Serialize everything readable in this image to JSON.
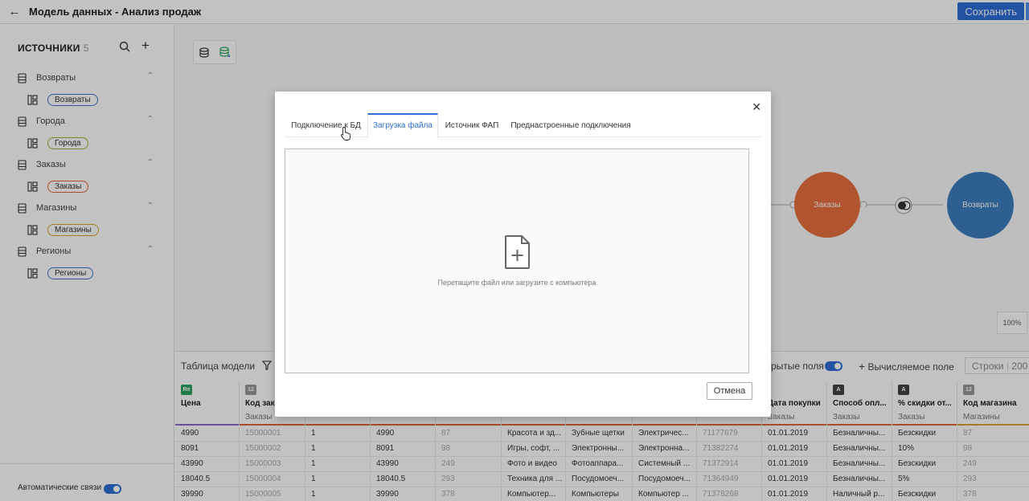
{
  "header": {
    "back_icon": "arrow-left-icon",
    "title": "Модель данных - Анализ продаж",
    "save_label": "Сохранить",
    "accent": "#2e6fd8"
  },
  "sidebar": {
    "heading": "ИСТОЧНИКИ",
    "count": "5",
    "sources": [
      {
        "name": "Возвраты",
        "table": "Возвраты",
        "color": "#3b76c4"
      },
      {
        "name": "Города",
        "table": "Города",
        "color": "#a7ae39"
      },
      {
        "name": "Заказы",
        "table": "Заказы",
        "color": "#e4643c"
      },
      {
        "name": "Магазины",
        "table": "Магазины",
        "color": "#d4a62a"
      },
      {
        "name": "Регионы",
        "table": "Регионы",
        "color": "#3b76c4"
      }
    ],
    "auto_links_label": "Автоматические связи"
  },
  "canvas": {
    "nodes": [
      {
        "label": "Заказы",
        "color": "#e8703e"
      },
      {
        "label": "Возвраты",
        "color": "#3d7dbf"
      }
    ],
    "zoom": "100%"
  },
  "table": {
    "title": "Таблица модели",
    "hidden_fields_label": "рытые поля",
    "calc_field_label": "Вычисляемое поле",
    "rows_label": "Строки",
    "rows_value": "200",
    "columns": [
      {
        "type": "Re",
        "name": "Цена",
        "table": "",
        "icon_color": "#2ba55f",
        "bar": "#8b6bc4"
      },
      {
        "type": "12",
        "name": "Код зака",
        "table": "Заказы",
        "icon_color": "#999",
        "bar": "#e4643c"
      },
      {
        "type": "",
        "name": "",
        "table": "",
        "icon_color": "#999",
        "bar": "#e4643c"
      },
      {
        "type": "",
        "name": "",
        "table": "",
        "icon_color": "#999",
        "bar": "#e4643c"
      },
      {
        "type": "",
        "name": "",
        "table": "",
        "icon_color": "#999",
        "bar": "#e4643c"
      },
      {
        "type": "",
        "name": "",
        "table": "",
        "icon_color": "#999",
        "bar": "#e4643c"
      },
      {
        "type": "",
        "name": "",
        "table": "",
        "icon_color": "#999",
        "bar": "#e4643c"
      },
      {
        "type": "",
        "name": "",
        "table": "",
        "icon_color": "#999",
        "bar": "#e4643c"
      },
      {
        "type": "",
        "name": "",
        "table": "",
        "icon_color": "#999",
        "bar": "#e4643c"
      },
      {
        "type": "",
        "name": "Дата покупки",
        "table": "Заказы",
        "icon_color": "#444",
        "bar": "#e4643c"
      },
      {
        "type": "A",
        "name": "Способ опл...",
        "table": "Заказы",
        "icon_color": "#444",
        "bar": "#e4643c"
      },
      {
        "type": "A",
        "name": "% скидки от...",
        "table": "Заказы",
        "icon_color": "#444",
        "bar": "#e4643c"
      },
      {
        "type": "12",
        "name": "Код магазина",
        "table": "Магазины",
        "icon_color": "#999",
        "bar": "#d4a62a"
      }
    ],
    "rows": [
      [
        "4990",
        "15000001",
        "1",
        "4990",
        "87",
        "Красота и зд...",
        "Зубные щетки",
        "Электричес...",
        "71177679",
        "01.01.2019",
        "Безналичны...",
        "Безскидки",
        "87"
      ],
      [
        "8091",
        "15000002",
        "1",
        "8091",
        "98",
        "Игры, софт, ...",
        "Электронны...",
        "Электронна...",
        "71382274",
        "01.01.2019",
        "Безналичны...",
        "10%",
        "98"
      ],
      [
        "43990",
        "15000003",
        "1",
        "43990",
        "249",
        "Фото и видео",
        "Фотоаппара...",
        "Системный ...",
        "71372914",
        "01.01.2019",
        "Безналичны...",
        "Безскидки",
        "249"
      ],
      [
        "18040.5",
        "15000004",
        "1",
        "18040.5",
        "293",
        "Техника для ...",
        "Посудомоеч...",
        "Посудомоеч...",
        "71364949",
        "01.01.2019",
        "Безналичны...",
        "5%",
        "293"
      ],
      [
        "39990",
        "15000005",
        "1",
        "39990",
        "378",
        "Компьютер...",
        "Компьютеры",
        "Компьютер ...",
        "71378268",
        "01.01.2019",
        "Наличный р...",
        "Безскидки",
        "378"
      ]
    ]
  },
  "modal": {
    "close_icon": "close-icon",
    "tabs": [
      "Подключение к БД",
      "Загрузка файла",
      "Источник ФАП",
      "Преднастроенные подключения"
    ],
    "active_tab": 1,
    "drop_text": "Перетащите файл или загрузите с компьютера",
    "cancel_label": "Отмена"
  }
}
